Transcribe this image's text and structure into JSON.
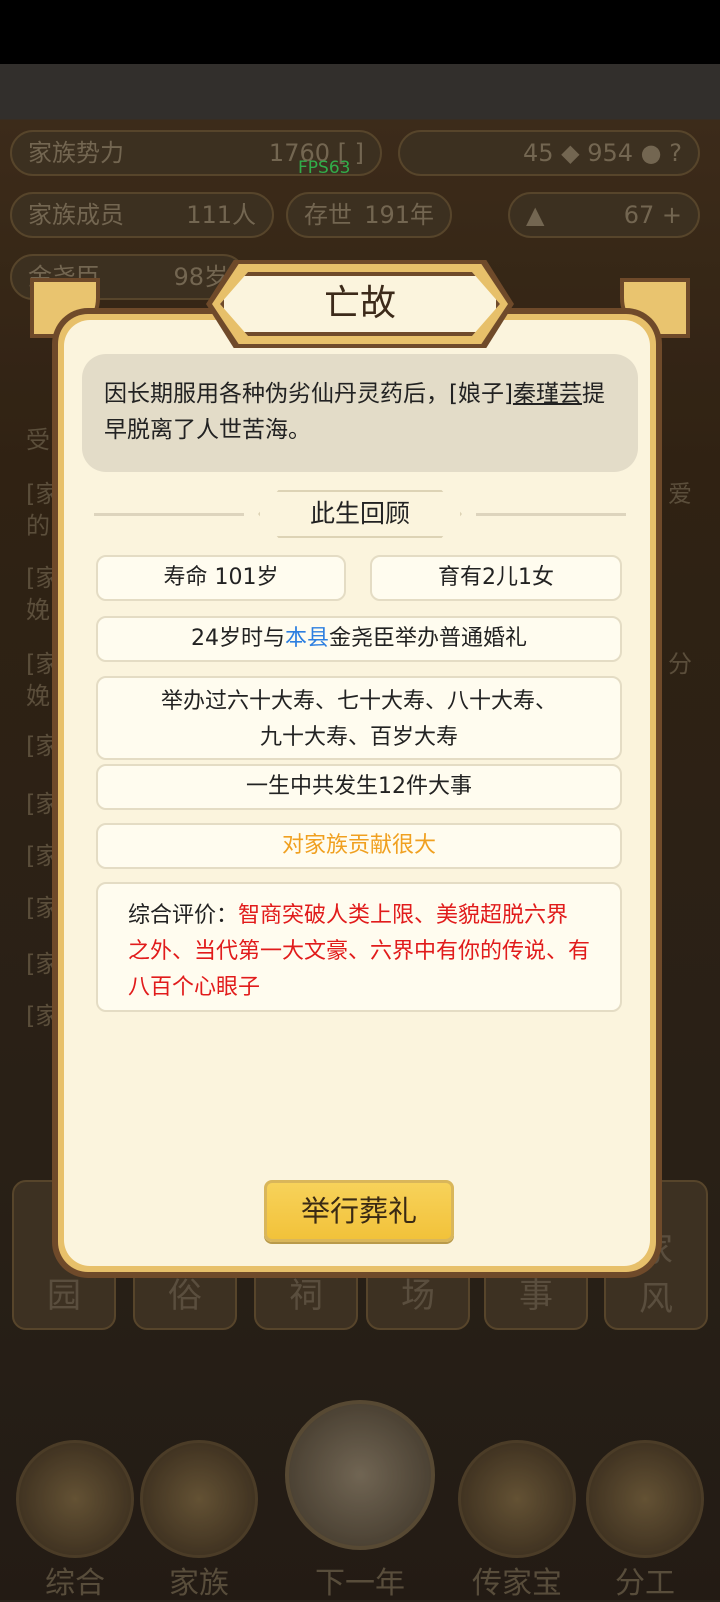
{
  "hud": {
    "power_label": "家族势力",
    "power_value": "1760",
    "power_bracket": "[ ]",
    "res_count": "45",
    "coins": "954",
    "members_label": "家族成员",
    "members_value": "111人",
    "alive_label": "存世",
    "alive_value": "191年",
    "gold": "67",
    "elder_name": "金尧臣",
    "elder_age": "98岁",
    "fps": "FPS63"
  },
  "bg_side": {
    "left": [
      "受",
      "[家",
      "的",
      "[家",
      "娩",
      "[家",
      "娩",
      "[家",
      "[家",
      "[家",
      "[家",
      "[家",
      "[家"
    ],
    "right": [
      "爱",
      "分"
    ]
  },
  "bg_cards": [
    "园",
    "俗",
    "祠",
    "场",
    "事",
    "风"
  ],
  "bg_card_top": "家",
  "bottom_nav": [
    "综合",
    "家族",
    "下一年",
    "传家宝",
    "分工"
  ],
  "dialog": {
    "title": "亡故",
    "cause_pre": "因长期服用各种伪劣仙丹灵药后，[娘子]",
    "cause_name": "秦瑾芸",
    "cause_post": "提早脱离了人世苦海。",
    "review_title": "此生回顾",
    "lifespan": "寿命 101岁",
    "children": "育有2儿1女",
    "marriage_pre": "24岁时与",
    "marriage_place": "本县",
    "marriage_post": "金尧臣举办普通婚礼",
    "birthdays_line1": "举办过六十大寿、七十大寿、八十大寿、",
    "birthdays_line2": "九十大寿、百岁大寿",
    "events": "一生中共发生12件大事",
    "contribution": "对家族贡献很大",
    "eval_label": "综合评价：",
    "eval_text": "智商突破人类上限、美貌超脱六界之外、当代第一大文豪、六界中有你的传说、有八百个心眼子",
    "funeral_button": "举行葬礼"
  },
  "colors": {
    "accent_blue": "#2d7fe0",
    "orange": "#f0a020",
    "red": "#e11b1b",
    "button_gold": "#f2c23a",
    "frame_brown": "#6f4a2a"
  }
}
